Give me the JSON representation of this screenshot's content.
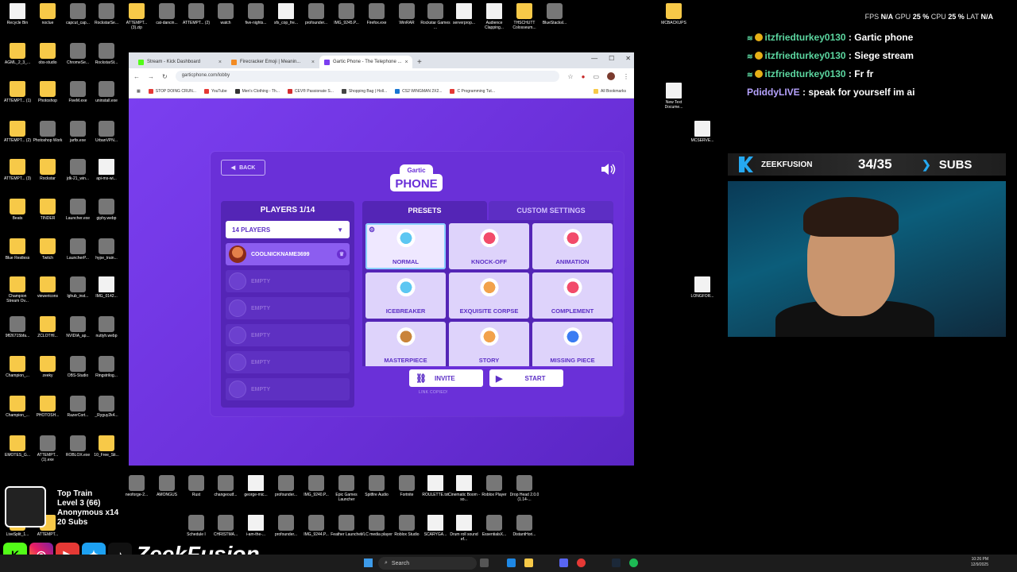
{
  "desktop": {
    "icons": [
      {
        "label": "Recycle Bin",
        "kind": "file"
      },
      {
        "label": "nocluе",
        "kind": "folder"
      },
      {
        "label": "capcut_cap...",
        "kind": "app"
      },
      {
        "label": "RockstarSe...",
        "kind": "app"
      },
      {
        "label": "ATTEMPT... (3).zip",
        "kind": "folder"
      },
      {
        "label": "cat-dancin...",
        "kind": "app"
      },
      {
        "label": "ATTEMPT... (2)",
        "kind": "app"
      },
      {
        "label": "watch",
        "kind": "app"
      },
      {
        "label": "five-nights...",
        "kind": "app"
      },
      {
        "label": "sfx_cop_fre...",
        "kind": "file"
      },
      {
        "label": "profounder...",
        "kind": "app"
      },
      {
        "label": "IMG_9245.P...",
        "kind": "app"
      },
      {
        "label": "Firefox.exe",
        "kind": "app"
      },
      {
        "label": "WinRAR",
        "kind": "app"
      },
      {
        "label": "Rockstar Games ...",
        "kind": "app"
      },
      {
        "label": "serverprop...",
        "kind": "file"
      },
      {
        "label": "Audience Clapping...",
        "kind": "file"
      },
      {
        "label": "THSCHUTT Colosseum...",
        "kind": "folder"
      },
      {
        "label": "BlueStacksl...",
        "kind": "app"
      },
      {
        "label": "MCBACKUPS",
        "kind": "folder"
      },
      {
        "label": "New Text Docume...",
        "kind": "file"
      },
      {
        "label": "MCSERVE...",
        "kind": "file"
      },
      {
        "label": "LONGFOR...",
        "kind": "file"
      },
      {
        "label": "AGML_2_3_...",
        "kind": "folder"
      },
      {
        "label": "obs-studio",
        "kind": "folder"
      },
      {
        "label": "ChromeSe...",
        "kind": "app"
      },
      {
        "label": "RockstarSt...",
        "kind": "app"
      },
      {
        "label": "ATTEMPT... (1)",
        "kind": "folder"
      },
      {
        "label": "Photoshop",
        "kind": "folder"
      },
      {
        "label": "FiveM.exe",
        "kind": "app"
      },
      {
        "label": "uninstall.exe",
        "kind": "app"
      },
      {
        "label": "ATTEMPT... (2)",
        "kind": "folder"
      },
      {
        "label": "Photoshop Work",
        "kind": "app"
      },
      {
        "label": "jarfix.exe",
        "kind": "app"
      },
      {
        "label": "UrbanVPN...",
        "kind": "app"
      },
      {
        "label": "ATTEMPT... (3)",
        "kind": "folder"
      },
      {
        "label": "Rockstar",
        "kind": "folder"
      },
      {
        "label": "jdk-21_win...",
        "kind": "app"
      },
      {
        "label": "api-ms-wi...",
        "kind": "file"
      },
      {
        "label": "Beats",
        "kind": "folder"
      },
      {
        "label": "TINDER",
        "kind": "folder"
      },
      {
        "label": "Launcher.exe",
        "kind": "app"
      },
      {
        "label": "giphy.webp",
        "kind": "app"
      },
      {
        "label": "Blue Restless",
        "kind": "folder"
      },
      {
        "label": "Twitch",
        "kind": "folder"
      },
      {
        "label": "LauncherP...",
        "kind": "app"
      },
      {
        "label": "hype_train...",
        "kind": "app"
      },
      {
        "label": "Champion Stream Ov...",
        "kind": "folder"
      },
      {
        "label": "viewericons",
        "kind": "folder"
      },
      {
        "label": "lghub_inst...",
        "kind": "app"
      },
      {
        "label": "IMG_0142...",
        "kind": "file"
      },
      {
        "label": "9ff26715bfa...",
        "kind": "app"
      },
      {
        "label": "ZCLOTHI...",
        "kind": "folder"
      },
      {
        "label": "NVIDIA_ap...",
        "kind": "app"
      },
      {
        "label": "nuttyh.webp",
        "kind": "app"
      },
      {
        "label": "Champion_...",
        "kind": "folder"
      },
      {
        "label": "zeeky",
        "kind": "folder"
      },
      {
        "label": "OBS-Studio",
        "kind": "app"
      },
      {
        "label": "Ringstrilog...",
        "kind": "app"
      },
      {
        "label": "Champion_...",
        "kind": "folder"
      },
      {
        "label": "PHOTOSH...",
        "kind": "folder"
      },
      {
        "label": "RazerCort...",
        "kind": "app"
      },
      {
        "label": "_Ryguy2k4...",
        "kind": "app"
      },
      {
        "label": "EMOTES_G...",
        "kind": "folder"
      },
      {
        "label": "ATTEMPT... (1).exe",
        "kind": "app"
      },
      {
        "label": "ROBLOX.exe",
        "kind": "app"
      },
      {
        "label": "10_Free_Sti...",
        "kind": "folder"
      },
      {
        "label": "neoforge-2...",
        "kind": "app"
      },
      {
        "label": "AMONGUS",
        "kind": "app"
      },
      {
        "label": "Rust",
        "kind": "app"
      },
      {
        "label": "changeoutf...",
        "kind": "app"
      },
      {
        "label": "george-mic...",
        "kind": "file"
      },
      {
        "label": "profounder...",
        "kind": "app"
      },
      {
        "label": "IMG_9240.P...",
        "kind": "app"
      },
      {
        "label": "Epic Games Launcher",
        "kind": "app"
      },
      {
        "label": "Spitfire Audio",
        "kind": "app"
      },
      {
        "label": "Fortnite",
        "kind": "app"
      },
      {
        "label": "ROULETTE.txt",
        "kind": "file"
      },
      {
        "label": "Cinematic Boom - so...",
        "kind": "file"
      },
      {
        "label": "Roblox Player",
        "kind": "app"
      },
      {
        "label": "Drop Head 2.0.0 (1.14-...",
        "kind": "app"
      },
      {
        "label": "LiveSplit_1...",
        "kind": "folder"
      },
      {
        "label": "ATTEMPT...",
        "kind": "folder"
      },
      {
        "label": "Schedule I",
        "kind": "app"
      },
      {
        "label": "CHRISTMA...",
        "kind": "app"
      },
      {
        "label": "i-am-the-...",
        "kind": "file"
      },
      {
        "label": "profounder...",
        "kind": "app"
      },
      {
        "label": "IMG_9244.P...",
        "kind": "app"
      },
      {
        "label": "Feather Launcher",
        "kind": "app"
      },
      {
        "label": "VLC media player",
        "kind": "app"
      },
      {
        "label": "Roblox Studio",
        "kind": "app"
      },
      {
        "label": "SCARYGA...",
        "kind": "file"
      },
      {
        "label": "Drum roll sound ef...",
        "kind": "file"
      },
      {
        "label": "EssentialsX...",
        "kind": "app"
      },
      {
        "label": "DistantHori...",
        "kind": "app"
      }
    ]
  },
  "browser": {
    "tabs": [
      {
        "label": "Stream - Kick Dashboard",
        "color": "#53fc18",
        "active": false
      },
      {
        "label": "Firecracker Emoji | Meanin...",
        "color": "#f28b24",
        "active": false
      },
      {
        "label": "Gartic Phone - The Telephone ...",
        "color": "#7b3ff0",
        "active": true
      }
    ],
    "new_tab": "+",
    "url": "garticphone.com/lobby",
    "bookmarks": [
      {
        "label": "STOP DOING CRUN...",
        "color": "#e53935"
      },
      {
        "label": "YouTube",
        "color": "#e53935"
      },
      {
        "label": "Men's Clothing - Th...",
        "color": "#333333"
      },
      {
        "label": "CEV® Passionate S...",
        "color": "#d32f2f"
      },
      {
        "label": "Shopping Bag | Holl...",
        "color": "#444444"
      },
      {
        "label": "CS2 WINGMAN 2X2...",
        "color": "#1976d2"
      },
      {
        "label": "C Programming Tut...",
        "color": "#e53935"
      }
    ],
    "all_bookmarks": "All Bookmarks"
  },
  "game": {
    "back_label": "BACK",
    "logo_line1": "Gartic",
    "logo_line2": "PHONE",
    "players_title": "PLAYERS 1/14",
    "players_select": "14 PLAYERS",
    "host_name": "COOLNICKNAME3699",
    "empty_label": "EMPTY",
    "tab_presets": "PRESETS",
    "tab_custom": "CUSTOM SETTINGS",
    "presets": [
      {
        "label": "NORMAL",
        "selected": true,
        "color": "#5cc7f2"
      },
      {
        "label": "KNOCK-OFF",
        "selected": false,
        "color": "#f24b6a"
      },
      {
        "label": "ANIMATION",
        "selected": false,
        "color": "#f24b6a"
      },
      {
        "label": "ICEBREAKER",
        "selected": false,
        "color": "#5cc7f2"
      },
      {
        "label": "EXQUISITE CORPSE",
        "selected": false,
        "color": "#f2a24b"
      },
      {
        "label": "COMPLEMENT",
        "selected": false,
        "color": "#f24b6a"
      },
      {
        "label": "MASTERPIECE",
        "selected": false,
        "color": "#c9843a"
      },
      {
        "label": "STORY",
        "selected": false,
        "color": "#f2a24b"
      },
      {
        "label": "MISSING PIECE",
        "selected": false,
        "color": "#3a7cf2"
      }
    ],
    "invite_label": "INVITE",
    "start_label": "START",
    "link_copied": "LINK COPIED!"
  },
  "overlay": {
    "hud": {
      "fps": "FPS",
      "fps_val": "N/A",
      "gpu": "GPU",
      "gpu_val": "25 %",
      "cpu": "CPU",
      "cpu_val": "25 %",
      "lat": "LAT",
      "lat_val": "N/A"
    },
    "chat": [
      {
        "user": "itzfriedturkey0130",
        "msg": "Gartic phone",
        "sub": true
      },
      {
        "user": "itzfriedturkey0130",
        "msg": "Siege stream",
        "sub": true
      },
      {
        "user": "itzfriedturkey0130",
        "msg": "Fr fr",
        "sub": true
      },
      {
        "user": "PdiddyLIVE",
        "msg": "speak for yourself im ai",
        "sub": false
      }
    ],
    "subs": {
      "name": "ZEEKFUSION",
      "count": "34/35",
      "label": "SUBS"
    },
    "train": {
      "title": "Top Train",
      "level": "Level 3 (66)",
      "anon": "Anonymous x14",
      "subs": "20 Subs"
    },
    "brand": "ZeekFusion"
  },
  "taskbar": {
    "search_placeholder": "Search",
    "time": "10:26 PM",
    "date": "12/9/2025"
  }
}
